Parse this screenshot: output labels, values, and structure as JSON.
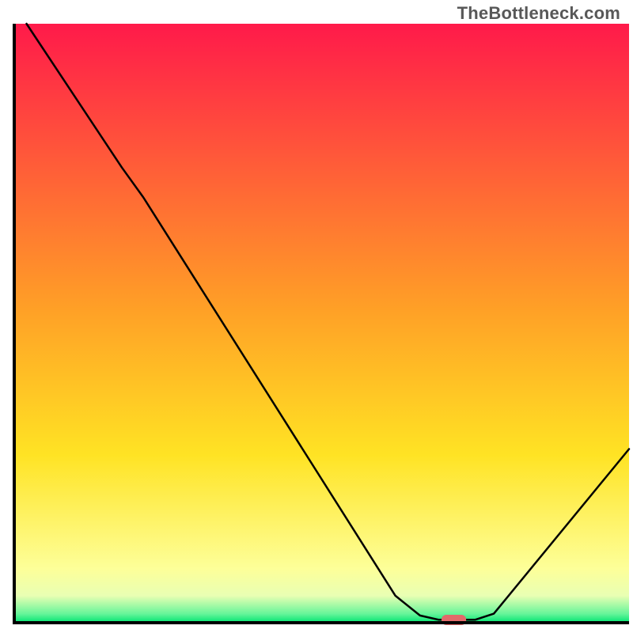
{
  "watermark": "TheBottleneck.com",
  "chart_data": {
    "type": "line",
    "title": "",
    "xlabel": "",
    "ylabel": "",
    "xlim": [
      0,
      100
    ],
    "ylim": [
      0,
      100
    ],
    "background_gradient": {
      "stops": [
        {
          "offset": 0.0,
          "color": "#ff1a4a"
        },
        {
          "offset": 0.48,
          "color": "#ffa126"
        },
        {
          "offset": 0.72,
          "color": "#ffe324"
        },
        {
          "offset": 0.91,
          "color": "#fdff99"
        },
        {
          "offset": 0.955,
          "color": "#e9ffb3"
        },
        {
          "offset": 0.985,
          "color": "#67f59a"
        },
        {
          "offset": 1.0,
          "color": "#00e472"
        }
      ]
    },
    "curve_points": [
      {
        "x": 2.0,
        "y": 100.0
      },
      {
        "x": 17.5,
        "y": 76.0
      },
      {
        "x": 21.0,
        "y": 71.0
      },
      {
        "x": 62.0,
        "y": 4.5
      },
      {
        "x": 66.0,
        "y": 1.2
      },
      {
        "x": 69.0,
        "y": 0.5
      },
      {
        "x": 75.0,
        "y": 0.5
      },
      {
        "x": 78.0,
        "y": 1.5
      },
      {
        "x": 100.0,
        "y": 29.0
      }
    ],
    "marker": {
      "x_center": 71.5,
      "y": 0.0,
      "width_pct": 4.0,
      "color": "#e26a6a"
    },
    "axes": {
      "line_width": 4,
      "color": "#000000",
      "left_x_pct": 2.0,
      "bottom_y_pct": 0.0,
      "right_x_pct": 100.0,
      "top_y_pct": 100.0
    }
  }
}
